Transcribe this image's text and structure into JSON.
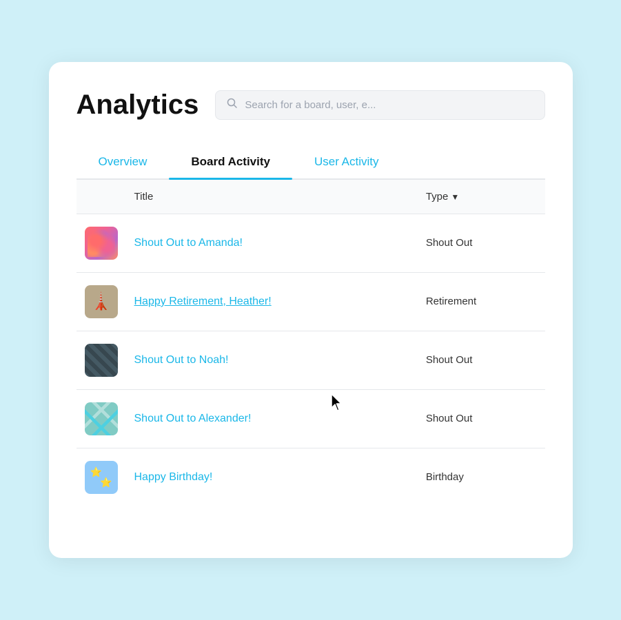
{
  "page": {
    "title": "Analytics",
    "search": {
      "placeholder": "Search for a board, user, e..."
    },
    "tabs": [
      {
        "id": "overview",
        "label": "Overview",
        "active": false
      },
      {
        "id": "board-activity",
        "label": "Board Activity",
        "active": true
      },
      {
        "id": "user-activity",
        "label": "User Activity",
        "active": false
      }
    ],
    "table": {
      "columns": [
        {
          "id": "title",
          "label": "Title"
        },
        {
          "id": "type",
          "label": "Type"
        }
      ],
      "rows": [
        {
          "id": "row-1",
          "title": "Shout Out to Amanda!",
          "type": "Shout Out",
          "thumb": "amanda",
          "underline": false
        },
        {
          "id": "row-2",
          "title": "Happy Retirement, Heather!",
          "type": "Retirement",
          "thumb": "heather",
          "underline": true
        },
        {
          "id": "row-3",
          "title": "Shout Out to Noah!",
          "type": "Shout Out",
          "thumb": "noah",
          "underline": false
        },
        {
          "id": "row-4",
          "title": "Shout Out to Alexander!",
          "type": "Shout Out",
          "thumb": "alexander",
          "underline": false
        },
        {
          "id": "row-5",
          "title": "Happy Birthday!",
          "type": "Birthday",
          "thumb": "birthday",
          "underline": false
        }
      ]
    }
  }
}
